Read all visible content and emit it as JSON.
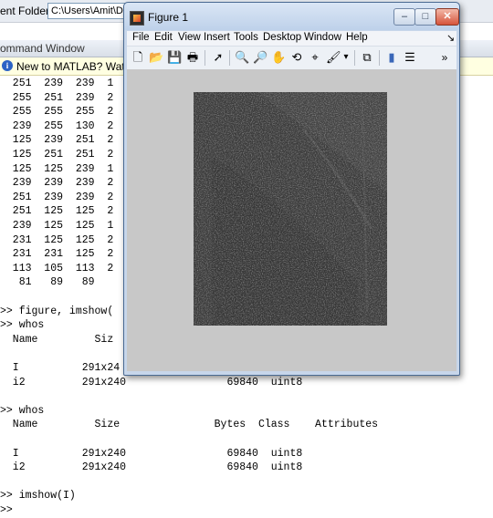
{
  "matlab": {
    "folder_label": "ent Folder:",
    "folder_path": "C:\\Users\\Amit\\D",
    "command_window_title": "ommand Window",
    "info_text": "New to MATLAB? Watch th",
    "console_lines": [
      "  251  239  239  1",
      "  255  251  239  2",
      "  255  255  255  2",
      "  239  255  130  2",
      "  125  239  251  2",
      "  125  251  251  2",
      "  125  125  239  1",
      "  239  239  239  2",
      "  251  239  239  2",
      "  251  125  125  2",
      "  239  125  125  1",
      "  231  125  125  2",
      "  231  231  125  2",
      "  113  105  113  2",
      "   81   89   89",
      "",
      ">> figure, imshow(",
      ">> whos",
      "  Name         Siz",
      "",
      "  I          291x24",
      "  i2         291x240                69840  uint8",
      "",
      ">> whos",
      "  Name         Size               Bytes  Class    Attributes",
      "",
      "  I          291x240                69840  uint8",
      "  i2         291x240                69840  uint8",
      "",
      ">> imshow(I)",
      ">>"
    ]
  },
  "figure": {
    "title": "Figure 1",
    "window_buttons": {
      "minimize": "–",
      "maximize": "□",
      "close": "✕"
    },
    "menu": [
      "File",
      "Edit",
      "View",
      "Insert",
      "Tools",
      "Desktop",
      "Window",
      "Help"
    ],
    "dock_glyph": "↘",
    "toolbar_overflow": "»",
    "toolbar_icons": [
      {
        "name": "new-figure-icon",
        "glyph": "🗋"
      },
      {
        "name": "open-file-icon",
        "glyph": "📂"
      },
      {
        "name": "save-icon",
        "glyph": "💾"
      },
      {
        "name": "print-icon",
        "glyph": "🖶"
      },
      {
        "name": "edit-plot-arrow-icon",
        "glyph": "➚"
      },
      {
        "name": "zoom-in-icon",
        "glyph": "🔍"
      },
      {
        "name": "zoom-out-icon",
        "glyph": "🔎"
      },
      {
        "name": "pan-hand-icon",
        "glyph": "✋"
      },
      {
        "name": "rotate-3d-icon",
        "glyph": "⟲"
      },
      {
        "name": "data-cursor-icon",
        "glyph": "⌖"
      },
      {
        "name": "brush-icon",
        "glyph": "🖌"
      },
      {
        "name": "brush-dropdown-icon",
        "glyph": "▾"
      },
      {
        "name": "link-plot-icon",
        "glyph": "⧉"
      },
      {
        "name": "colorbar-icon",
        "glyph": "▮"
      },
      {
        "name": "legend-icon",
        "glyph": "☰"
      }
    ]
  }
}
